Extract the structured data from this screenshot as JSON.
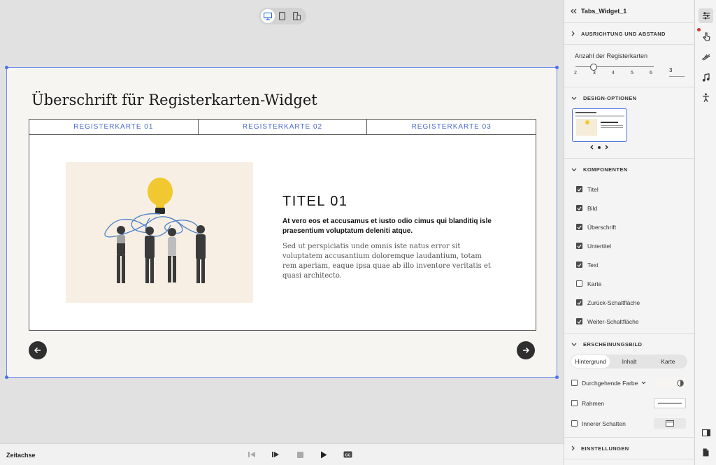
{
  "canvas": {
    "slide_title": "Überschrift für Registerkarten-Widget",
    "tabs": [
      "REGISTERKARTE 01",
      "REGISTERKARTE 02",
      "REGISTERKARTE 03"
    ],
    "panel": {
      "title": "TITEL 01",
      "subtitle": "At vero eos et accusamus et iusto odio cimus qui blanditiq isle praesentium voluptatum deleniti atque.",
      "body": "Sed ut perspiciatis unde omnis iste natus error sit voluptatem accusantium doloremque laudantium, totam rem aperiam, eaque ipsa quae ab illo inventore veritatis et quasi architecto."
    }
  },
  "timeline": {
    "label": "Zeitachse"
  },
  "props": {
    "widget_name": "Tabs_Widget_1",
    "sections": {
      "alignment": "AUSRICHTUNG UND ABSTAND",
      "design": "DESIGN-OPTIONEN",
      "components": "KOMPONENTEN",
      "appearance": "ERSCHEINUNGSBILD",
      "settings": "EINSTELLUNGEN"
    },
    "tab_count": {
      "label": "Anzahl der Registerkarten",
      "ticks": [
        "2",
        "3",
        "4",
        "5",
        "6"
      ],
      "value": "3"
    },
    "components": [
      {
        "label": "Titel",
        "checked": true
      },
      {
        "label": "Bild",
        "checked": true
      },
      {
        "label": "Überschrift",
        "checked": true
      },
      {
        "label": "Untertitel",
        "checked": true
      },
      {
        "label": "Text",
        "checked": true
      },
      {
        "label": "Karte",
        "checked": false
      },
      {
        "label": "Zurück-Schaltfläche",
        "checked": true
      },
      {
        "label": "Weiter-Schaltfläche",
        "checked": true
      }
    ],
    "appearance_tabs": [
      "Hintergrund",
      "Inhalt",
      "Karte"
    ],
    "appearance_options": {
      "solid_fill": "Durchgehende Farbe",
      "border": "Rahmen",
      "inner_shadow": "Innerer Schatten"
    }
  },
  "colors": {
    "accent": "#4b6bd1",
    "selection": "#6b8ff0",
    "bulb": "#f2c830"
  }
}
